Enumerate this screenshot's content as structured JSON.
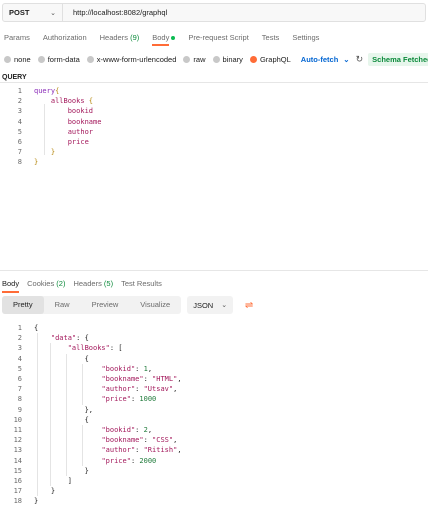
{
  "request": {
    "method": "POST",
    "url": "http://localhost:8082/graphql"
  },
  "request_tabs": [
    {
      "label": "Params"
    },
    {
      "label": "Authorization"
    },
    {
      "label": "Headers",
      "badge": "(9)"
    },
    {
      "label": "Body",
      "active": true
    },
    {
      "label": "Pre-request Script"
    },
    {
      "label": "Tests"
    },
    {
      "label": "Settings"
    }
  ],
  "body_types": [
    "none",
    "form-data",
    "x-www-form-urlencoded",
    "raw",
    "binary",
    "GraphQL"
  ],
  "selected_body_type": "GraphQL",
  "auto_fetch_label": "Auto-fetch",
  "schema_status": "Schema Fetched",
  "query_label": "QUERY",
  "query_lines": [
    {
      "n": "1",
      "t": "query{"
    },
    {
      "n": "2",
      "t": "    allBooks {"
    },
    {
      "n": "3",
      "t": "        bookid"
    },
    {
      "n": "4",
      "t": "        bookname"
    },
    {
      "n": "5",
      "t": "        author"
    },
    {
      "n": "6",
      "t": "        price"
    },
    {
      "n": "7",
      "t": "    }"
    },
    {
      "n": "8",
      "t": "}"
    }
  ],
  "response_tabs": [
    {
      "label": "Body",
      "active": true
    },
    {
      "label": "Cookies",
      "count": "(2)"
    },
    {
      "label": "Headers",
      "count": "(5)"
    },
    {
      "label": "Test Results"
    }
  ],
  "format_modes": [
    "Pretty",
    "Raw",
    "Preview",
    "Visualize"
  ],
  "selected_format_mode": "Pretty",
  "format_language": "JSON",
  "response_lines": [
    {
      "n": "1",
      "t": "{"
    },
    {
      "n": "2",
      "t": "    \"data\": {"
    },
    {
      "n": "3",
      "t": "        \"allBooks\": ["
    },
    {
      "n": "4",
      "t": "            {"
    },
    {
      "n": "5",
      "t": "                \"bookid\": 1,"
    },
    {
      "n": "6",
      "t": "                \"bookname\": \"HTML\","
    },
    {
      "n": "7",
      "t": "                \"author\": \"Utsav\","
    },
    {
      "n": "8",
      "t": "                \"price\": 1000"
    },
    {
      "n": "9",
      "t": "            },"
    },
    {
      "n": "10",
      "t": "            {"
    },
    {
      "n": "11",
      "t": "                \"bookid\": 2,"
    },
    {
      "n": "12",
      "t": "                \"bookname\": \"CSS\","
    },
    {
      "n": "13",
      "t": "                \"author\": \"Ritish\","
    },
    {
      "n": "14",
      "t": "                \"price\": 2000"
    },
    {
      "n": "15",
      "t": "            }"
    },
    {
      "n": "16",
      "t": "        ]"
    },
    {
      "n": "17",
      "t": "    }"
    },
    {
      "n": "18",
      "t": "}"
    }
  ],
  "colors": {
    "accent": "#ff6c37",
    "link": "#0265d2",
    "success": "#0b8a3a"
  }
}
